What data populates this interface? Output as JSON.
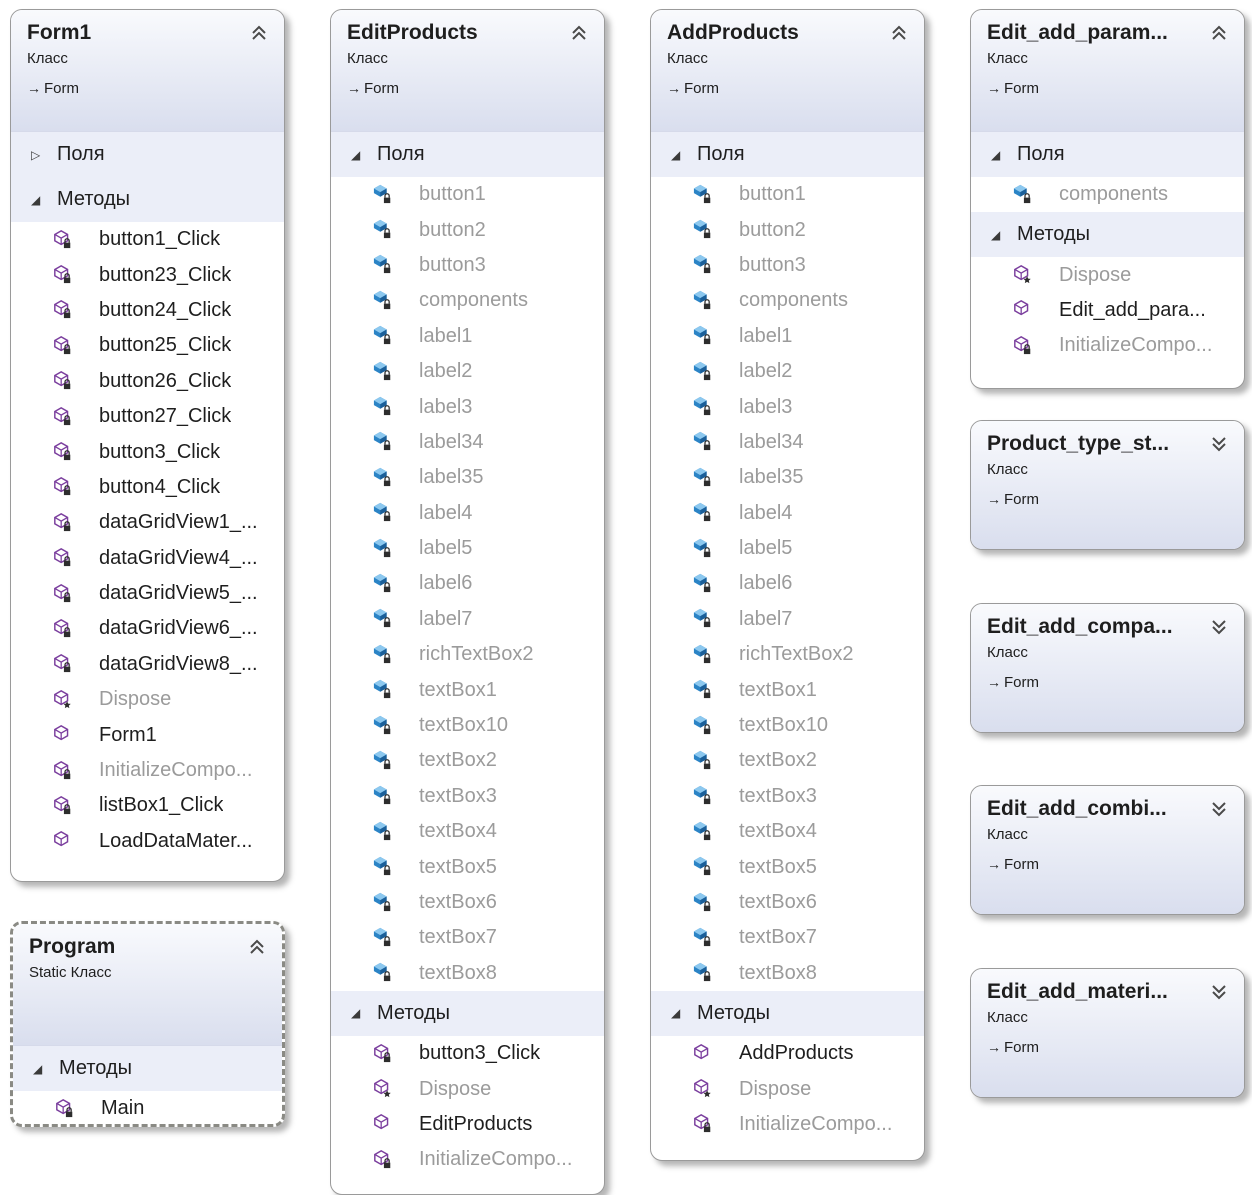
{
  "labels": {
    "fields": "Поля",
    "methods": "Методы"
  },
  "classes": [
    {
      "id": "form1",
      "name": "Form1",
      "kind": "Класс",
      "base": "Form",
      "fields_expanded": false,
      "fields": [],
      "methods": [
        {
          "name": "button1_Click",
          "icon": "private-method-icon",
          "muted": false
        },
        {
          "name": "button23_Click",
          "icon": "private-method-icon",
          "muted": false
        },
        {
          "name": "button24_Click",
          "icon": "private-method-icon",
          "muted": false
        },
        {
          "name": "button25_Click",
          "icon": "private-method-icon",
          "muted": false
        },
        {
          "name": "button26_Click",
          "icon": "private-method-icon",
          "muted": false
        },
        {
          "name": "button27_Click",
          "icon": "private-method-icon",
          "muted": false
        },
        {
          "name": "button3_Click",
          "icon": "private-method-icon",
          "muted": false
        },
        {
          "name": "button4_Click",
          "icon": "private-method-icon",
          "muted": false
        },
        {
          "name": "dataGridView1_...",
          "icon": "private-method-icon",
          "muted": false
        },
        {
          "name": "dataGridView4_...",
          "icon": "private-method-icon",
          "muted": false
        },
        {
          "name": "dataGridView5_...",
          "icon": "private-method-icon",
          "muted": false
        },
        {
          "name": "dataGridView6_...",
          "icon": "private-method-icon",
          "muted": false
        },
        {
          "name": "dataGridView8_...",
          "icon": "private-method-icon",
          "muted": false
        },
        {
          "name": "Dispose",
          "icon": "protected-method-icon",
          "muted": true
        },
        {
          "name": "Form1",
          "icon": "public-method-icon",
          "muted": false
        },
        {
          "name": "InitializeCompo...",
          "icon": "private-method-icon",
          "muted": true
        },
        {
          "name": "listBox1_Click",
          "icon": "private-method-icon",
          "muted": false
        },
        {
          "name": "LoadDataMater...",
          "icon": "public-method-icon",
          "muted": false
        }
      ]
    },
    {
      "id": "program",
      "name": "Program",
      "kind": "Static Класс",
      "base": "",
      "static": true,
      "methods": [
        {
          "name": "Main",
          "icon": "private-method-icon",
          "muted": false
        }
      ]
    },
    {
      "id": "editproducts",
      "name": "EditProducts",
      "kind": "Класс",
      "base": "Form",
      "fields_expanded": true,
      "fields": [
        "button1",
        "button2",
        "button3",
        "components",
        "label1",
        "label2",
        "label3",
        "label34",
        "label35",
        "label4",
        "label5",
        "label6",
        "label7",
        "richTextBox2",
        "textBox1",
        "textBox10",
        "textBox2",
        "textBox3",
        "textBox4",
        "textBox5",
        "textBox6",
        "textBox7",
        "textBox8"
      ],
      "methods": [
        {
          "name": "button3_Click",
          "icon": "private-method-icon",
          "muted": false
        },
        {
          "name": "Dispose",
          "icon": "protected-method-icon",
          "muted": true
        },
        {
          "name": "EditProducts",
          "icon": "public-method-icon",
          "muted": false
        },
        {
          "name": "InitializeCompo...",
          "icon": "private-method-icon",
          "muted": true
        }
      ]
    },
    {
      "id": "addproducts",
      "name": "AddProducts",
      "kind": "Класс",
      "base": "Form",
      "fields_expanded": true,
      "fields": [
        "button1",
        "button2",
        "button3",
        "components",
        "label1",
        "label2",
        "label3",
        "label34",
        "label35",
        "label4",
        "label5",
        "label6",
        "label7",
        "richTextBox2",
        "textBox1",
        "textBox10",
        "textBox2",
        "textBox3",
        "textBox4",
        "textBox5",
        "textBox6",
        "textBox7",
        "textBox8"
      ],
      "methods": [
        {
          "name": "AddProducts",
          "icon": "public-method-icon",
          "muted": false
        },
        {
          "name": "Dispose",
          "icon": "protected-method-icon",
          "muted": true
        },
        {
          "name": "InitializeCompo...",
          "icon": "private-method-icon",
          "muted": true
        }
      ]
    },
    {
      "id": "editaddparam",
      "name": "Edit_add_param...",
      "kind": "Класс",
      "base": "Form",
      "fields_expanded": true,
      "fields": [
        "components"
      ],
      "methods": [
        {
          "name": "Dispose",
          "icon": "protected-method-icon",
          "muted": true
        },
        {
          "name": "Edit_add_para...",
          "icon": "public-method-icon",
          "muted": false
        },
        {
          "name": "InitializeCompo...",
          "icon": "private-method-icon",
          "muted": true
        }
      ]
    },
    {
      "id": "producttype",
      "name": "Product_type_st...",
      "kind": "Класс",
      "base": "Form",
      "collapsed": true
    },
    {
      "id": "editaddcompa",
      "name": "Edit_add_compa...",
      "kind": "Класс",
      "base": "Form",
      "collapsed": true
    },
    {
      "id": "editaddcombi",
      "name": "Edit_add_combi...",
      "kind": "Класс",
      "base": "Form",
      "collapsed": true
    },
    {
      "id": "editaddmateri",
      "name": "Edit_add_materi...",
      "kind": "Класс",
      "base": "Form",
      "collapsed": true
    }
  ]
}
